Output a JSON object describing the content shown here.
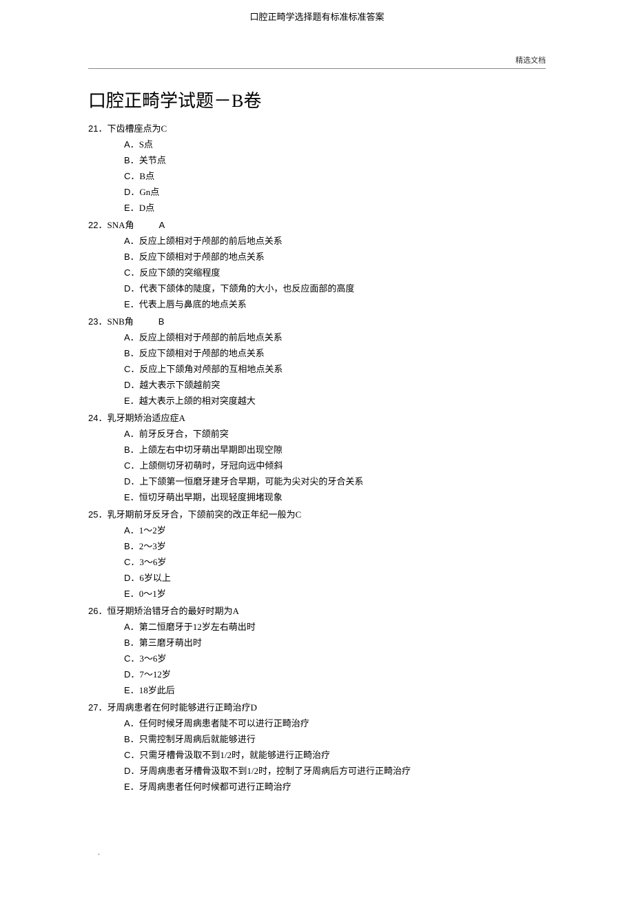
{
  "header": {
    "top_title": "口腔正畸学选择题有标准标准答案",
    "right_label": "精选文档"
  },
  "title": "口腔正畸学试题－B卷",
  "questions": [
    {
      "num": "21",
      "stem": "下齿槽座点为C",
      "answer_inline": "",
      "options": [
        {
          "label": "A",
          "text": "S点"
        },
        {
          "label": "B",
          "text": "关节点"
        },
        {
          "label": "C",
          "text": "B点"
        },
        {
          "label": "D",
          "text": "Gn点"
        },
        {
          "label": "E",
          "text": "D点"
        }
      ]
    },
    {
      "num": "22",
      "stem": "SNA角",
      "answer_inline": "A",
      "gap": true,
      "options": [
        {
          "label": "A",
          "text": "反应上颌相对于颅部的前后地点关系"
        },
        {
          "label": "B",
          "text": "反应下颌相对于颅部的地点关系"
        },
        {
          "label": "C",
          "text": "反应下颌的突缩程度"
        },
        {
          "label": "D",
          "text": "代表下颌体的陡度，下颌角的大小，也反应面部的高度"
        },
        {
          "label": "E",
          "text": "代表上唇与鼻底的地点关系"
        }
      ]
    },
    {
      "num": "23",
      "stem": "SNB角",
      "answer_inline": "B",
      "gap": true,
      "options": [
        {
          "label": "A",
          "text": "反应上颌相对于颅部的前后地点关系"
        },
        {
          "label": "B",
          "text": "反应下颌相对于颅部的地点关系"
        },
        {
          "label": "C",
          "text": "反应上下颌角对颅部的互相地点关系"
        },
        {
          "label": "D",
          "text": "越大表示下颌越前突"
        },
        {
          "label": "E",
          "text": "越大表示上颌的相对突度越大"
        }
      ]
    },
    {
      "num": "24",
      "stem": "乳牙期矫治适应症A",
      "answer_inline": "",
      "options": [
        {
          "label": "A",
          "text": "前牙反牙合，下颌前突"
        },
        {
          "label": "B",
          "text": "上颌左右中切牙萌出早期即出现空隙"
        },
        {
          "label": "C",
          "text": "上颌侧切牙初萌时，牙冠向远中倾斜"
        },
        {
          "label": "D",
          "text": "上下颌第一恒磨牙建牙合早期，可能为尖对尖的牙合关系"
        },
        {
          "label": "E",
          "text": "恒切牙萌出早期，出现轻度拥堵现象"
        }
      ]
    },
    {
      "num": "25",
      "stem": "乳牙期前牙反牙合，下颌前突的改正年纪一般为C",
      "answer_inline": "",
      "options": [
        {
          "label": "A",
          "text": "1～2岁"
        },
        {
          "label": "B",
          "text": "2～3岁"
        },
        {
          "label": "C",
          "text": "3～6岁"
        },
        {
          "label": "D",
          "text": "6岁以上"
        },
        {
          "label": "E",
          "text": "0～1岁"
        }
      ]
    },
    {
      "num": "26",
      "stem": "恒牙期矫治错牙合的最好时期为A",
      "answer_inline": "",
      "options": [
        {
          "label": "A",
          "text": "第二恒磨牙于12岁左右萌出时"
        },
        {
          "label": "B",
          "text": "第三磨牙萌出时"
        },
        {
          "label": "C",
          "text": "3～6岁"
        },
        {
          "label": "D",
          "text": "7～12岁"
        },
        {
          "label": "E",
          "text": "18岁此后"
        }
      ]
    },
    {
      "num": "27",
      "stem": "牙周病患者在何时能够进行正畸治疗D",
      "answer_inline": "",
      "options": [
        {
          "label": "A",
          "text": "任何时候牙周病患者陡不可以进行正畸治疗"
        },
        {
          "label": "B",
          "text": "只需控制牙周病后就能够进行"
        },
        {
          "label": "C",
          "text": "只需牙槽骨汲取不到1/2时，就能够进行正畸治疗"
        },
        {
          "label": "D",
          "text": "牙周病患者牙槽骨汲取不到1/2时，控制了牙周病后方可进行正畸治疗"
        },
        {
          "label": "E",
          "text": "牙周病患者任何时候都可进行正畸治疗"
        }
      ]
    }
  ],
  "page_number": "."
}
